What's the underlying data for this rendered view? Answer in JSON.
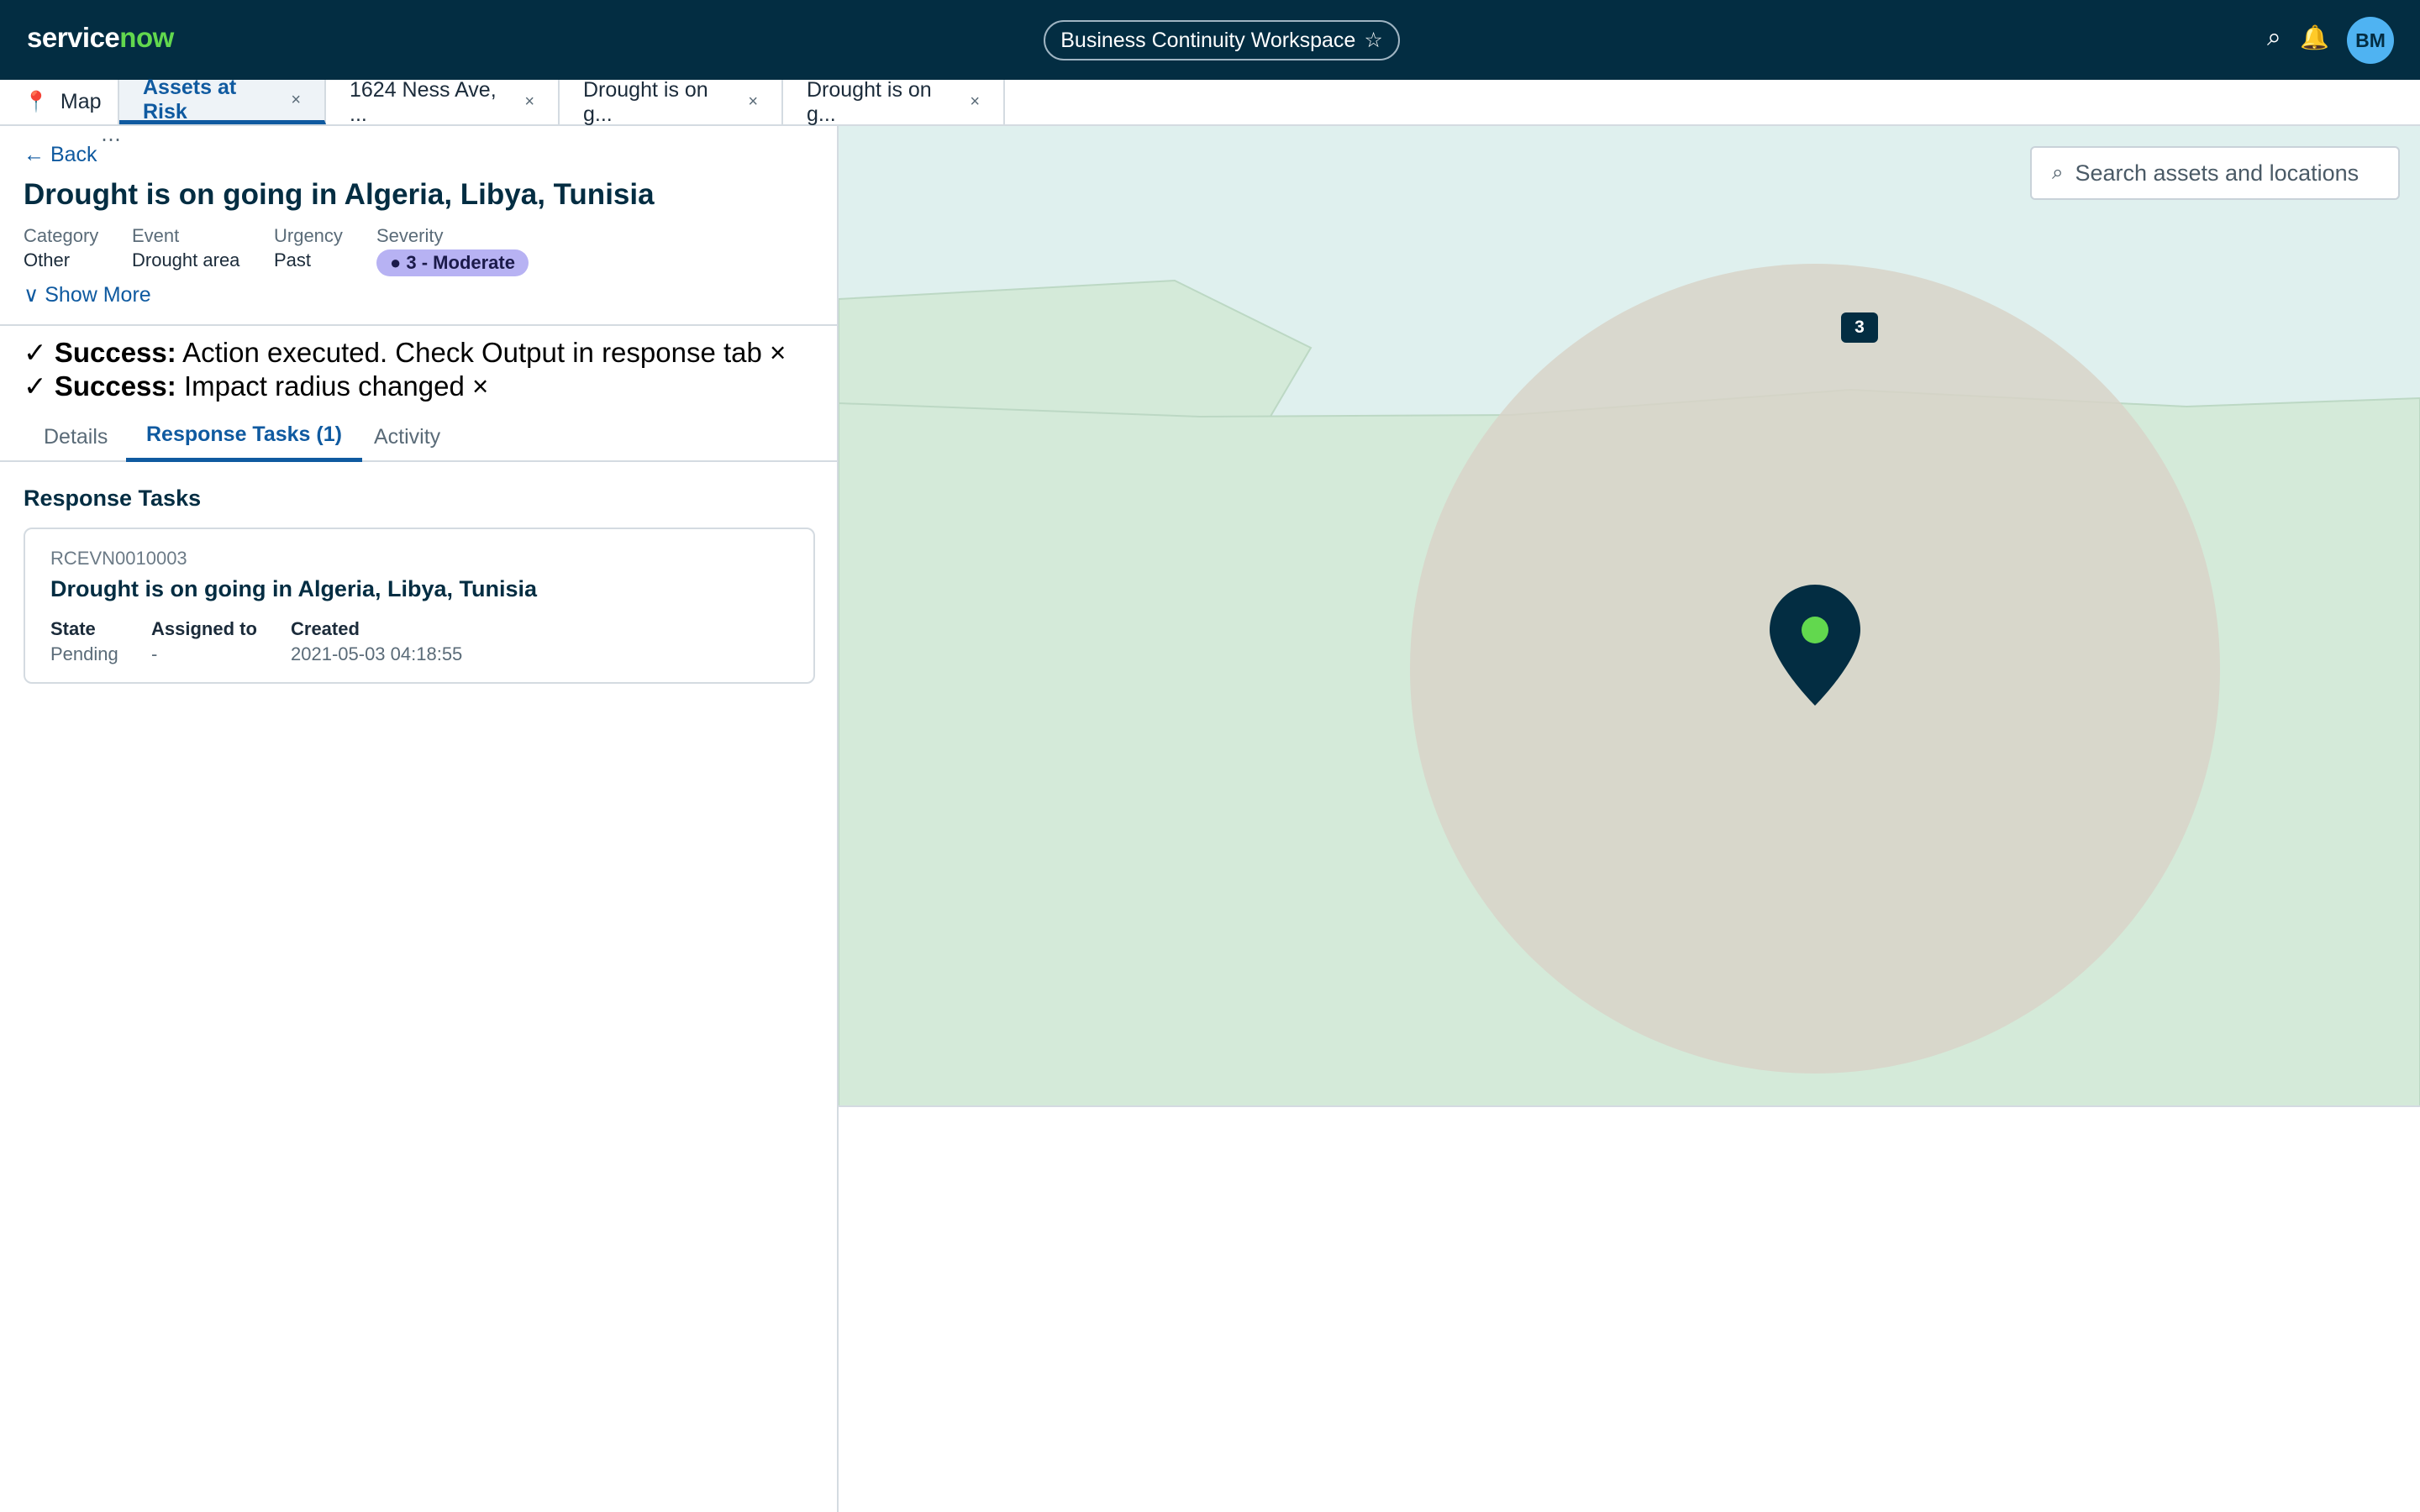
{
  "header": {
    "logo_service": "service",
    "logo_now": "now",
    "workspace_title": "Business Continuity Workspace",
    "star_icon": "☆",
    "search_icon": "⌕",
    "bell_icon": "🔔",
    "avatar_initials": "BM"
  },
  "tabs": [
    {
      "label": "Map",
      "icon": "📍"
    },
    {
      "label": "Assets at Risk",
      "close": "×"
    },
    {
      "label": "1624 Ness Ave, ...",
      "close": "×"
    },
    {
      "label": "Drought is on g...",
      "close": "×"
    },
    {
      "label": "Drought is on g...",
      "close": "×"
    }
  ],
  "detail": {
    "more": "⋯",
    "back": "← Back",
    "title": "Drought is on going in Algeria, Libya, Tunisia",
    "meta": [
      {
        "label": "Category",
        "value": "Other"
      },
      {
        "label": "Event",
        "value": "Drought area"
      },
      {
        "label": "Urgency",
        "value": "Past"
      },
      {
        "label": "Severity",
        "value": "● 3 - Moderate"
      }
    ],
    "show_more": "∨ Show More",
    "messages": [
      {
        "check": "✓",
        "strong": "Success:",
        "text": "Action executed. Check Output in response tab",
        "close": "×"
      },
      {
        "check": "✓",
        "strong": "Success:",
        "text": "Impact radius changed",
        "close": "×"
      }
    ],
    "subtabs": [
      "Details",
      "Response Tasks (1)",
      "Activity"
    ],
    "section_title": "Response Tasks",
    "task": {
      "number": "RCEVN0010003",
      "title": "Drought is on going in Algeria, Libya, Tunisia",
      "fields": [
        {
          "label": "State",
          "value": "Pending"
        },
        {
          "label": "Assigned to",
          "value": "-"
        },
        {
          "label": "Created",
          "value": "2021-05-03 04:18:55"
        }
      ]
    }
  },
  "map": {
    "search_icon": "⌕",
    "search_placeholder": "Search assets and locations",
    "cluster_count": "3",
    "colors": {
      "water": "#dff0ee",
      "land": "#d4ead9",
      "impact": "#d8d4c8",
      "pin": "#032d42",
      "pin_dot": "#62d84e"
    }
  }
}
